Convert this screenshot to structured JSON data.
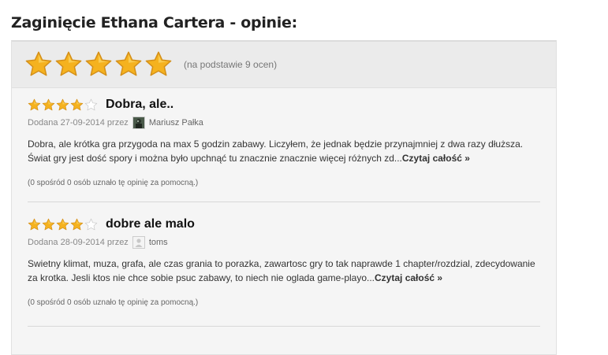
{
  "page": {
    "title": "Zaginięcie Ethana Cartera - opinie:"
  },
  "summary": {
    "rating": 5,
    "max_rating": 5,
    "note": "(na podstawie 9 ocen)"
  },
  "colors": {
    "star_fill": "#f5b21f",
    "star_empty": "#ffffff",
    "panel_bg": "#f5f5f5",
    "summary_bg": "#ebebeb"
  },
  "reviews": [
    {
      "rating": 4,
      "title": "Dobra, ale..",
      "date": "Dodana 27-09-2014 przez",
      "avatar": "photo-avatar-icon",
      "author": "Mariusz Pałka",
      "text": "Dobra, ale krótka gra przygoda na max 5 godzin zabawy. Liczyłem, że jednak będzie przynajmniej z dwa razy dłuższa. Świat gry jest dość spory i można było upchnąć tu znacznie znacznie więcej różnych zd...",
      "read_more": "Czytaj całość »",
      "helpful": "(0 spośród 0 osób uznało tę opinię za pomocną.)"
    },
    {
      "rating": 4,
      "title": "dobre ale malo",
      "date": "Dodana 28-09-2014 przez",
      "avatar": "default-user-icon",
      "author": "toms",
      "text": "Swietny klimat, muza, grafa, ale czas grania to porazka, zawartosc gry to tak naprawde 1 chapter/rozdzial, zdecydowanie za krotka. Jesli ktos nie chce sobie psuc zabawy, to niech nie oglada game-playo...",
      "read_more": "Czytaj całość »",
      "helpful": "(0 spośród 0 osób uznało tę opinię za pomocną.)"
    }
  ]
}
